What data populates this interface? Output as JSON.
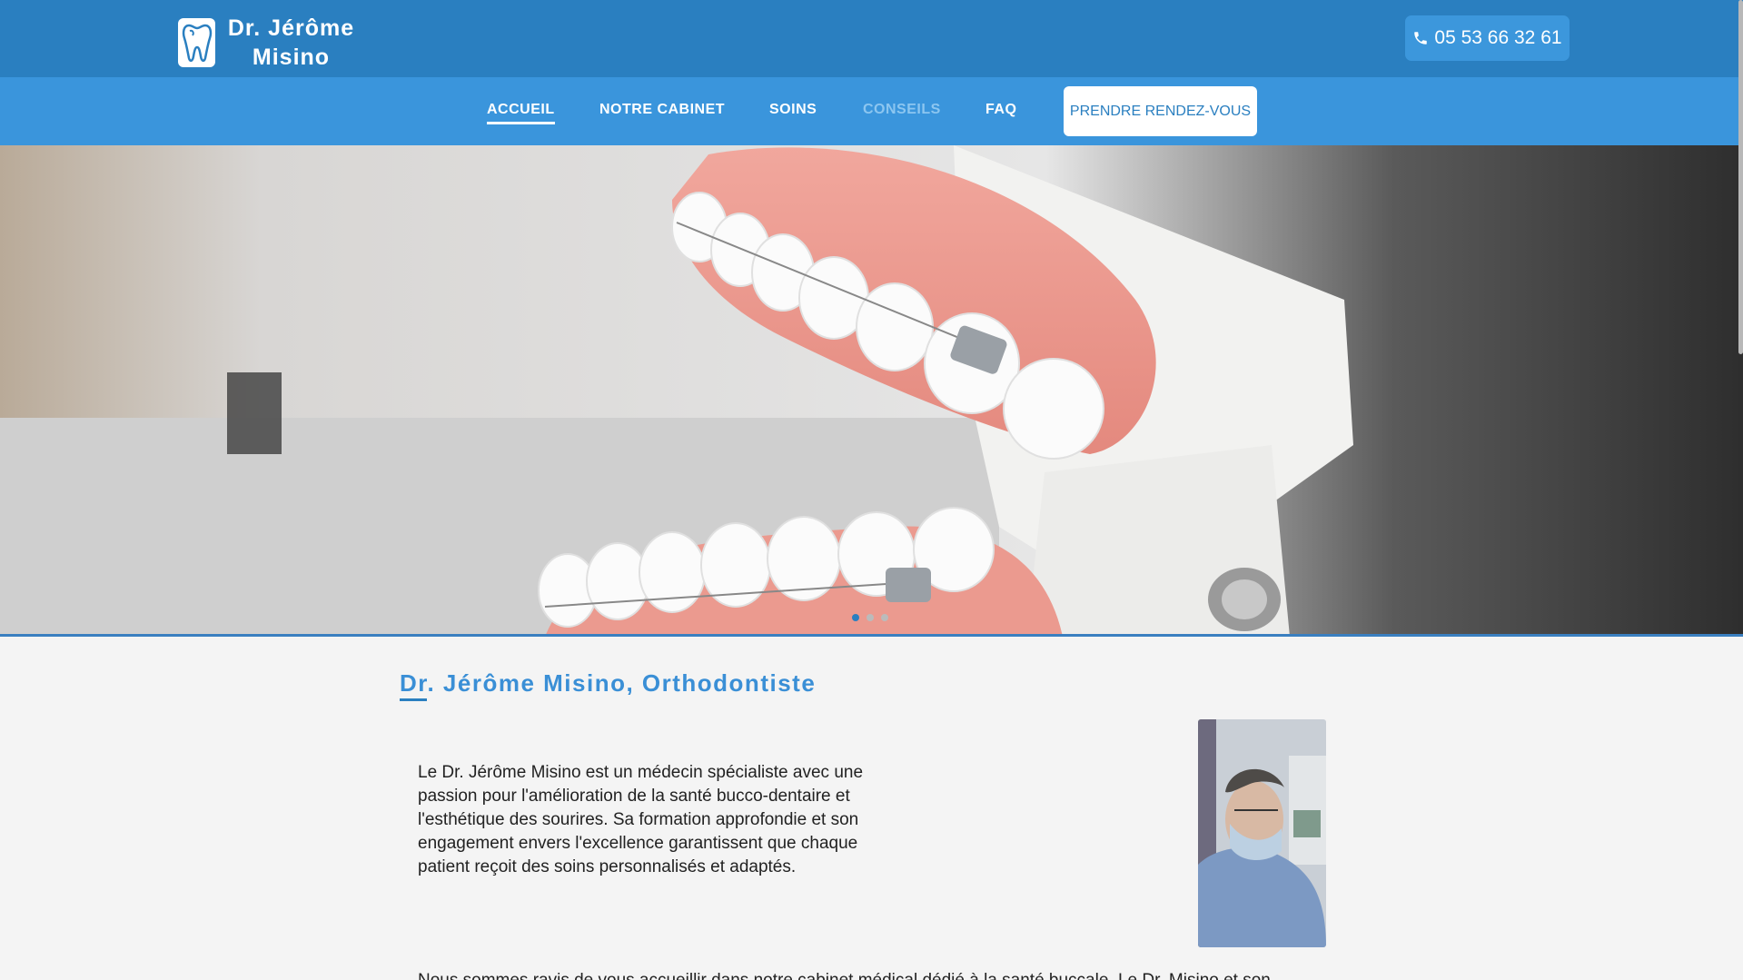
{
  "header": {
    "brand_line1": "Dr. Jérôme",
    "brand_line2": "Misino",
    "phone": "05 53 66 32 61"
  },
  "nav": {
    "items": [
      {
        "label": "ACCUEIL",
        "state": "active"
      },
      {
        "label": "NOTRE CABINET",
        "state": "normal"
      },
      {
        "label": "SOINS",
        "state": "normal"
      },
      {
        "label": "CONSEILS",
        "state": "muted"
      },
      {
        "label": "FAQ",
        "state": "normal"
      }
    ],
    "cta_label": "PRENDRE RENDEZ-VOUS"
  },
  "hero": {
    "image": "dental-braces-model",
    "slides": 3,
    "active_slide": 1
  },
  "main": {
    "title": "Dr. Jérôme Misino, Orthodontiste",
    "intro": "Le Dr. Jérôme Misino est un médecin spécialiste avec une passion pour l'amélioration de la santé bucco-dentaire et l'esthétique des sourires. Sa formation approfondie et son engagement envers l'excellence garantissent que chaque patient reçoit des soins personnalisés et adaptés.",
    "bottom_text": "Nous sommes ravis de vous accueillir dans notre cabinet médical dédié à la santé buccale. Le Dr. Misino et son",
    "portrait": "doctor-portrait"
  },
  "colors": {
    "topbar": "#2a7fc0",
    "navbar": "#3a95dc",
    "accent": "#3a8fd6"
  }
}
